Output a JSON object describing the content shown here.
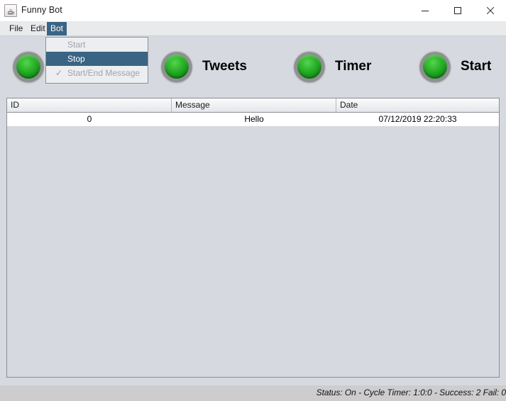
{
  "window": {
    "title": "Funny Bot",
    "icon": "java-coffee-cup-icon",
    "controls": {
      "minimize": "minimize-icon",
      "maximize": "maximize-icon",
      "close": "close-icon"
    }
  },
  "menubar": {
    "items": [
      {
        "label": "File",
        "selected": false
      },
      {
        "label": "Edit",
        "selected": false
      },
      {
        "label": "Bot",
        "selected": true
      }
    ]
  },
  "dropdown": {
    "open_for": "Bot",
    "items": [
      {
        "label": "Start",
        "enabled": false,
        "highlighted": false,
        "checked": false
      },
      {
        "label": "Stop",
        "enabled": true,
        "highlighted": true,
        "checked": false
      },
      {
        "label": "Start/End Message",
        "enabled": false,
        "highlighted": false,
        "checked": true,
        "check_glyph": "✓"
      }
    ]
  },
  "toolbar": {
    "buttons": [
      {
        "indicator": "green-led-on",
        "label": ""
      },
      {
        "indicator": "green-led-on",
        "label": "Tweets"
      },
      {
        "indicator": "green-led-on",
        "label": "Timer"
      },
      {
        "indicator": "green-led-on",
        "label": "Start"
      }
    ]
  },
  "table": {
    "columns": [
      "ID",
      "Message",
      "Date"
    ],
    "rows": [
      {
        "id": "0",
        "message": "Hello",
        "date": "07/12/2019 22:20:33"
      }
    ]
  },
  "statusbar": {
    "text": "Status: On - Cycle Timer: 1:0:0 - Success: 2 Fail: 0"
  },
  "colors": {
    "window_bg": "#d6d9e0",
    "menu_highlight": "#3a6484",
    "led_green": "#2db52b",
    "statusbar_bg": "#cdcdcd",
    "table_row_bg": "#ffffff"
  }
}
